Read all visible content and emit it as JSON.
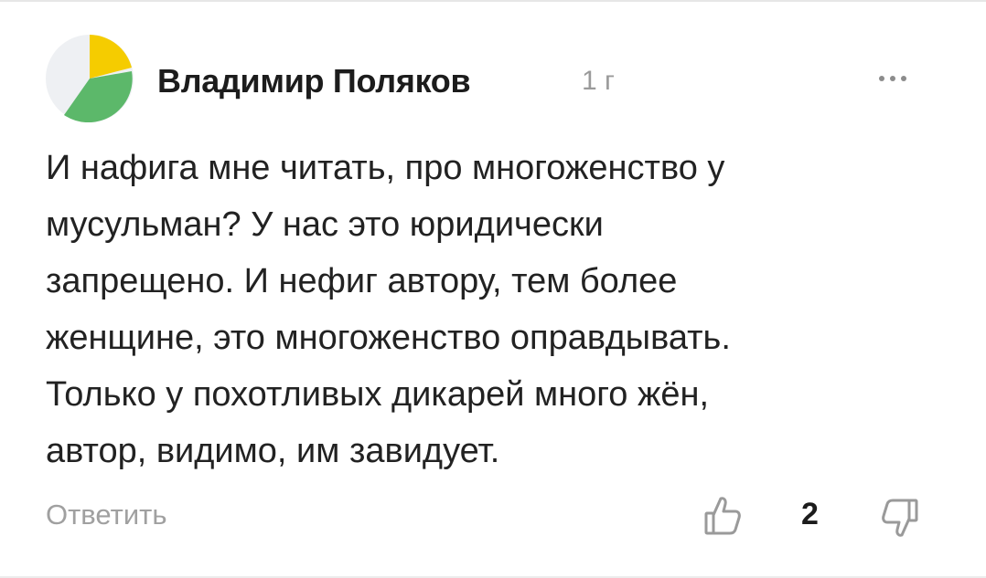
{
  "comment": {
    "author": "Владимир Поляков",
    "time": "1 г",
    "text_lines": [
      "И нафига мне читать, про многоженство у",
      "мусульман? У нас это юридически",
      "запрещено. И нефиг автору, тем более",
      "женщине, это многоженство оправдывать.",
      "Только у похотливых дикарей много жён,",
      "автор, видимо, им завидует."
    ],
    "reply_label": "Ответить",
    "like_count": "2"
  },
  "icons": {
    "avatar": "yellow-green-avatar-icon",
    "more": "more-dots-icon",
    "like": "thumbs-up-icon",
    "dislike": "thumbs-down-icon"
  },
  "colors": {
    "avatar_yellow": "#f5cc00",
    "avatar_green": "#5cb86a",
    "avatar_bg": "#eef0f3",
    "muted_text": "#9a9a9a"
  }
}
